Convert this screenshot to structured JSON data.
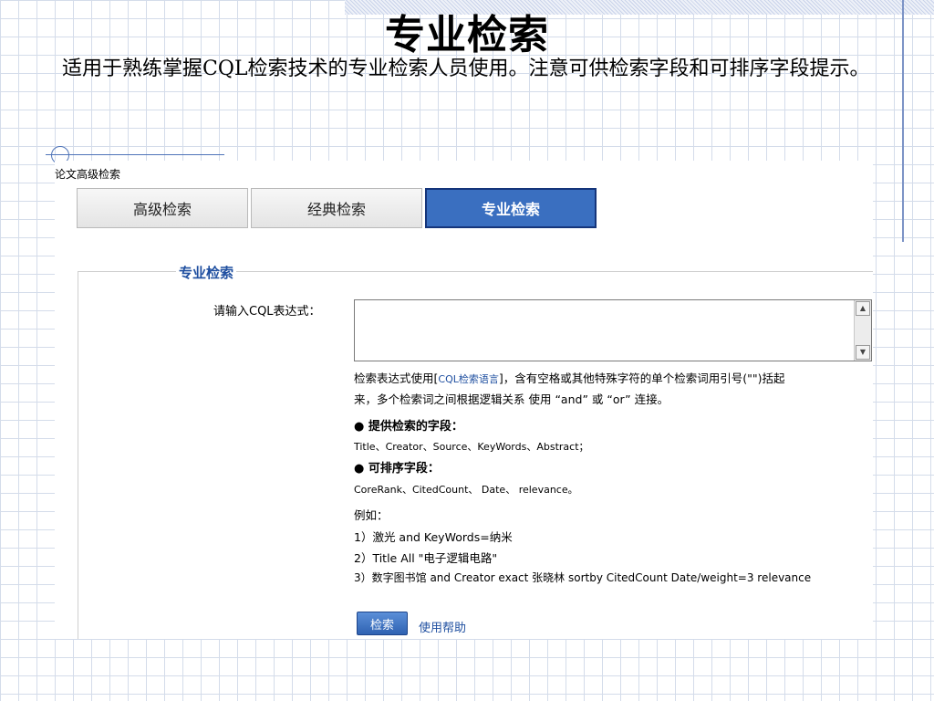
{
  "slide": {
    "title": "专业检索",
    "body": "适用于熟练掌握CQL检索技术的专业检索人员使用。注意可供检索字段和可排序字段提示。"
  },
  "screenshot": {
    "breadcrumb": "论文高级检索",
    "tabs": [
      {
        "label": "高级检索",
        "active": false
      },
      {
        "label": "经典检索",
        "active": false
      },
      {
        "label": "专业检索",
        "active": true
      }
    ],
    "section_legend": "专业检索",
    "expression_label": "请输入CQL表达式：",
    "expression_value": "",
    "help": {
      "line1_prefix": "检索表达式使用[",
      "line1_link": "CQL检索语言",
      "line1_suffix": "]，含有空格或其他特殊字符的单个检索词用引号(\"\")括起",
      "line2": "来，多个检索词之间根据逻辑关系 使用 “and” 或 “or” 连接。",
      "fields_heading": "● 提供检索的字段：",
      "fields_list": "Title、Creator、Source、KeyWords、Abstract；",
      "sort_heading": "● 可排序字段：",
      "sort_list": "CoreRank、CitedCount、  Date、  relevance。",
      "examples_heading": "例如：",
      "example1": "1）激光  and KeyWords=纳米",
      "example2": "2）Title All \"电子逻辑电路\"",
      "example3": "3）数字图书馆  and Creator exact 张晓林  sortby CitedCount Date/weight=3 relevance"
    },
    "search_button": "检索",
    "help_link": "使用帮助",
    "icons": {
      "scroll_up": "scroll-up-arrow-icon",
      "scroll_down": "scroll-down-arrow-icon"
    },
    "colors": {
      "active_tab": "#3a6fc0",
      "link": "#1f4fa0"
    }
  }
}
